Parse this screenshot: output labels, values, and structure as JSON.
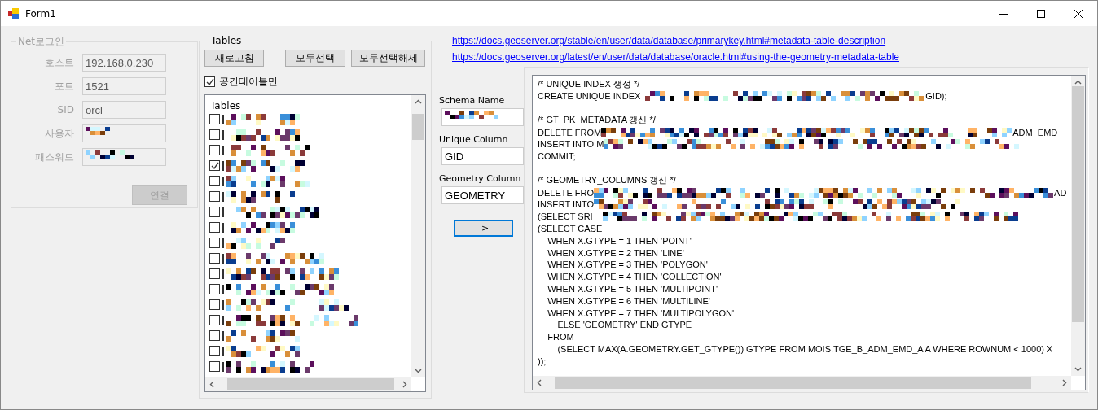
{
  "window": {
    "title": "Form1"
  },
  "login_group": {
    "title": "Net로그인",
    "disabled": true,
    "fields": [
      {
        "label": "호스트",
        "kind": "text",
        "value": "192.168.0.230"
      },
      {
        "label": "포트",
        "kind": "text",
        "value": "1521"
      },
      {
        "label": "SID",
        "kind": "text",
        "value": "orcl"
      },
      {
        "label": "사용자",
        "kind": "redacted"
      },
      {
        "label": "패스워드",
        "kind": "redacted"
      }
    ],
    "connect_button": "연결"
  },
  "tables_group": {
    "title": "Tables",
    "buttons": [
      "새로고침",
      "모두선택",
      "모두선택해제"
    ],
    "spatial_only": {
      "label": "공간테이블만",
      "checked": true
    },
    "list": {
      "header": "Tables",
      "items": [
        {
          "checked": false
        },
        {
          "checked": false
        },
        {
          "checked": false
        },
        {
          "checked": true
        },
        {
          "checked": false
        },
        {
          "checked": false
        },
        {
          "checked": false
        },
        {
          "checked": false
        },
        {
          "checked": false
        },
        {
          "checked": false
        },
        {
          "checked": false
        },
        {
          "checked": false
        },
        {
          "checked": false
        },
        {
          "checked": false
        },
        {
          "checked": false
        },
        {
          "checked": false
        },
        {
          "checked": false
        }
      ]
    }
  },
  "links": [
    "https://docs.geoserver.org/stable/en/user/data/database/primarykey.html#metadata-table-description",
    "https://docs.geoserver.org/latest/en/user/data/database/oracle.html#using-the-geometry-metadata-table"
  ],
  "schema_form": {
    "fields": [
      {
        "label": "Schema Name",
        "kind": "redacted"
      },
      {
        "label": "Unique Column",
        "kind": "text",
        "value": "GID"
      },
      {
        "label": "Geometry Column",
        "kind": "text",
        "value": "GEOMETRY"
      }
    ],
    "run_button": "->"
  },
  "sql": {
    "lines": [
      {
        "kind": "code",
        "parts": [
          {
            "kind": "text",
            "text": "/* UNIQUE INDEX 생성 */"
          }
        ]
      },
      {
        "kind": "code",
        "parts": [
          {
            "kind": "text",
            "text": "CREATE UNIQUE INDEX"
          },
          {
            "kind": "redacted"
          },
          {
            "kind": "text",
            "text": "GID);"
          }
        ]
      },
      {
        "kind": "blank"
      },
      {
        "kind": "code",
        "parts": [
          {
            "kind": "text",
            "text": "/* GT_PK_METADATA 갱신 */"
          }
        ]
      },
      {
        "kind": "code",
        "parts": [
          {
            "kind": "text",
            "text": "DELETE FROM"
          },
          {
            "kind": "redacted"
          },
          {
            "kind": "text",
            "text": "ADM_EMD"
          }
        ]
      },
      {
        "kind": "code",
        "parts": [
          {
            "kind": "text",
            "text": "INSERT INTO M"
          },
          {
            "kind": "redacted"
          }
        ]
      },
      {
        "kind": "code",
        "parts": [
          {
            "kind": "text",
            "text": "COMMIT;"
          }
        ]
      },
      {
        "kind": "blank"
      },
      {
        "kind": "code",
        "parts": [
          {
            "kind": "text",
            "text": "/* GEOMETRY_COLUMNS 갱신 */"
          }
        ]
      },
      {
        "kind": "code",
        "parts": [
          {
            "kind": "text",
            "text": "DELETE FRO"
          },
          {
            "kind": "redacted"
          },
          {
            "kind": "text",
            "text": "AD"
          }
        ]
      },
      {
        "kind": "code",
        "parts": [
          {
            "kind": "text",
            "text": "INSERT INTO"
          },
          {
            "kind": "redacted"
          }
        ]
      },
      {
        "kind": "code",
        "parts": [
          {
            "kind": "text",
            "text": "(SELECT SRI"
          },
          {
            "kind": "redacted"
          }
        ]
      },
      {
        "kind": "code",
        "parts": [
          {
            "kind": "text",
            "text": "(SELECT CASE"
          }
        ]
      },
      {
        "kind": "code",
        "parts": [
          {
            "kind": "text",
            "text": "    WHEN X.GTYPE = 1 THEN 'POINT'"
          }
        ]
      },
      {
        "kind": "code",
        "parts": [
          {
            "kind": "text",
            "text": "    WHEN X.GTYPE = 2 THEN 'LINE'"
          }
        ]
      },
      {
        "kind": "code",
        "parts": [
          {
            "kind": "text",
            "text": "    WHEN X.GTYPE = 3 THEN 'POLYGON'"
          }
        ]
      },
      {
        "kind": "code",
        "parts": [
          {
            "kind": "text",
            "text": "    WHEN X.GTYPE = 4 THEN 'COLLECTION'"
          }
        ]
      },
      {
        "kind": "code",
        "parts": [
          {
            "kind": "text",
            "text": "    WHEN X.GTYPE = 5 THEN 'MULTIPOINT'"
          }
        ]
      },
      {
        "kind": "code",
        "parts": [
          {
            "kind": "text",
            "text": "    WHEN X.GTYPE = 6 THEN 'MULTILINE'"
          }
        ]
      },
      {
        "kind": "code",
        "parts": [
          {
            "kind": "text",
            "text": "    WHEN X.GTYPE = 7 THEN 'MULTIPOLYGON'"
          }
        ]
      },
      {
        "kind": "code",
        "parts": [
          {
            "kind": "text",
            "text": "        ELSE 'GEOMETRY' END GTYPE"
          }
        ]
      },
      {
        "kind": "code",
        "parts": [
          {
            "kind": "text",
            "text": "    FROM"
          }
        ]
      },
      {
        "kind": "code",
        "parts": [
          {
            "kind": "text",
            "text": "        (SELECT MAX(A.GEOMETRY.GET_GTYPE()) GTYPE FROM MOIS.TGE_B_ADM_EMD_A A WHERE ROWNUM < 1000) X"
          }
        ]
      },
      {
        "kind": "code",
        "parts": [
          {
            "kind": "text",
            "text": "));"
          }
        ]
      }
    ]
  }
}
